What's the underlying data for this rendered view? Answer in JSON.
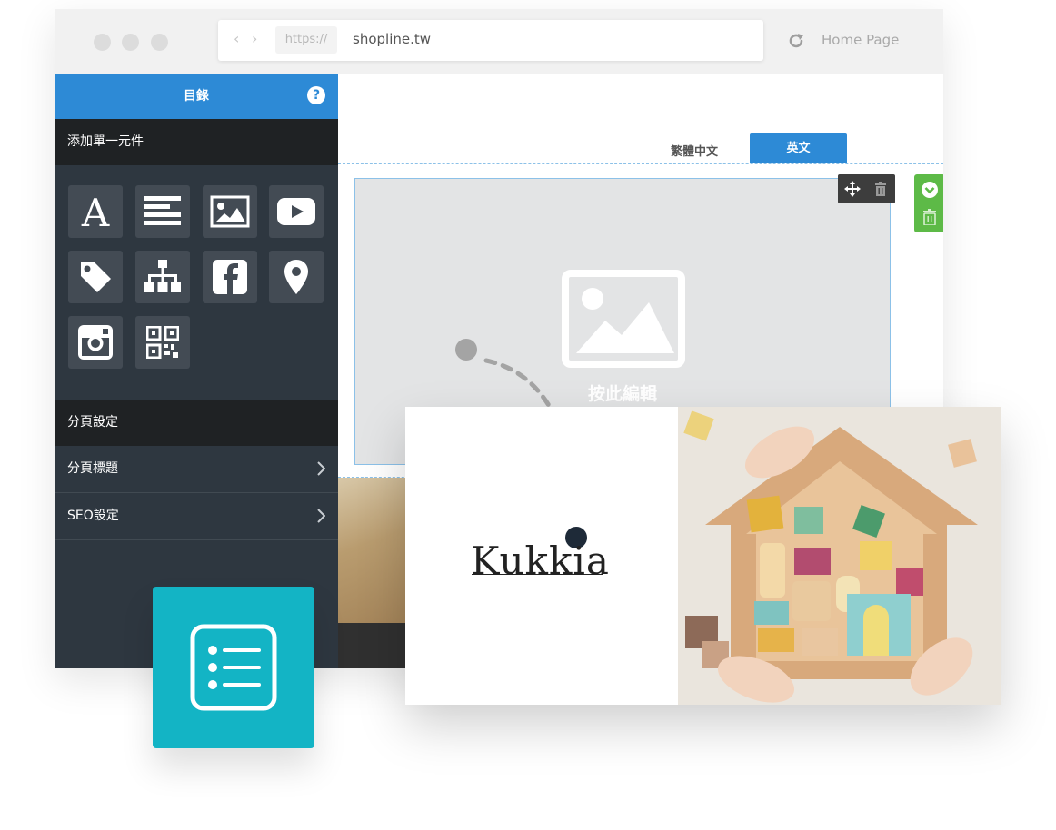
{
  "browser": {
    "url_protocol": "https://",
    "url_domain": "shopline.tw",
    "home_label": "Home Page"
  },
  "sidebar": {
    "title": "目錄",
    "help_glyph": "?",
    "add_element_heading": "添加單一元件",
    "tools": [
      {
        "name": "text-icon"
      },
      {
        "name": "paragraph-icon"
      },
      {
        "name": "image-icon"
      },
      {
        "name": "youtube-icon"
      },
      {
        "name": "tag-icon"
      },
      {
        "name": "sitemap-icon"
      },
      {
        "name": "facebook-icon"
      },
      {
        "name": "map-pin-icon"
      },
      {
        "name": "instagram-icon"
      },
      {
        "name": "qr-code-icon"
      }
    ],
    "page_settings_heading": "分頁設定",
    "rows": [
      {
        "label": "分頁標題"
      },
      {
        "label": "SEO設定"
      }
    ]
  },
  "canvas": {
    "lang_tabs": [
      {
        "label": "繁體中文",
        "active": false
      },
      {
        "label": "英文",
        "active": true
      }
    ],
    "image_placeholder_label": "按此編輯"
  },
  "card": {
    "logo_text": "Kukkia"
  },
  "colors": {
    "accent_blue": "#2d8ad6",
    "sidebar_bg": "#2e3740",
    "badge_teal": "#13b4c5",
    "toolbar_green": "#5dba47"
  }
}
